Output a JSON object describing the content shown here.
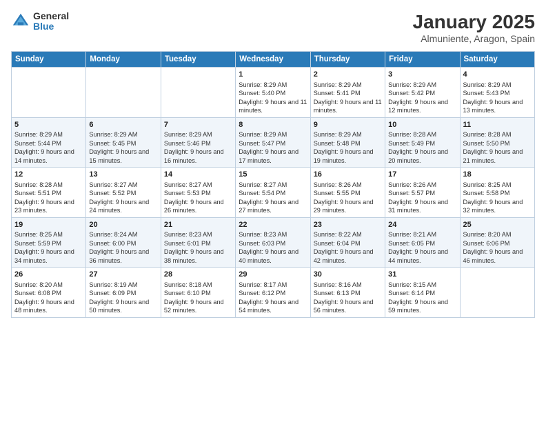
{
  "header": {
    "logo_general": "General",
    "logo_blue": "Blue",
    "title": "January 2025",
    "subtitle": "Almuniente, Aragon, Spain"
  },
  "weekdays": [
    "Sunday",
    "Monday",
    "Tuesday",
    "Wednesday",
    "Thursday",
    "Friday",
    "Saturday"
  ],
  "weeks": [
    [
      {
        "day": "",
        "sunrise": "",
        "sunset": "",
        "daylight": ""
      },
      {
        "day": "",
        "sunrise": "",
        "sunset": "",
        "daylight": ""
      },
      {
        "day": "",
        "sunrise": "",
        "sunset": "",
        "daylight": ""
      },
      {
        "day": "1",
        "sunrise": "Sunrise: 8:29 AM",
        "sunset": "Sunset: 5:40 PM",
        "daylight": "Daylight: 9 hours and 11 minutes."
      },
      {
        "day": "2",
        "sunrise": "Sunrise: 8:29 AM",
        "sunset": "Sunset: 5:41 PM",
        "daylight": "Daylight: 9 hours and 11 minutes."
      },
      {
        "day": "3",
        "sunrise": "Sunrise: 8:29 AM",
        "sunset": "Sunset: 5:42 PM",
        "daylight": "Daylight: 9 hours and 12 minutes."
      },
      {
        "day": "4",
        "sunrise": "Sunrise: 8:29 AM",
        "sunset": "Sunset: 5:43 PM",
        "daylight": "Daylight: 9 hours and 13 minutes."
      }
    ],
    [
      {
        "day": "5",
        "sunrise": "Sunrise: 8:29 AM",
        "sunset": "Sunset: 5:44 PM",
        "daylight": "Daylight: 9 hours and 14 minutes."
      },
      {
        "day": "6",
        "sunrise": "Sunrise: 8:29 AM",
        "sunset": "Sunset: 5:45 PM",
        "daylight": "Daylight: 9 hours and 15 minutes."
      },
      {
        "day": "7",
        "sunrise": "Sunrise: 8:29 AM",
        "sunset": "Sunset: 5:46 PM",
        "daylight": "Daylight: 9 hours and 16 minutes."
      },
      {
        "day": "8",
        "sunrise": "Sunrise: 8:29 AM",
        "sunset": "Sunset: 5:47 PM",
        "daylight": "Daylight: 9 hours and 17 minutes."
      },
      {
        "day": "9",
        "sunrise": "Sunrise: 8:29 AM",
        "sunset": "Sunset: 5:48 PM",
        "daylight": "Daylight: 9 hours and 19 minutes."
      },
      {
        "day": "10",
        "sunrise": "Sunrise: 8:28 AM",
        "sunset": "Sunset: 5:49 PM",
        "daylight": "Daylight: 9 hours and 20 minutes."
      },
      {
        "day": "11",
        "sunrise": "Sunrise: 8:28 AM",
        "sunset": "Sunset: 5:50 PM",
        "daylight": "Daylight: 9 hours and 21 minutes."
      }
    ],
    [
      {
        "day": "12",
        "sunrise": "Sunrise: 8:28 AM",
        "sunset": "Sunset: 5:51 PM",
        "daylight": "Daylight: 9 hours and 23 minutes."
      },
      {
        "day": "13",
        "sunrise": "Sunrise: 8:27 AM",
        "sunset": "Sunset: 5:52 PM",
        "daylight": "Daylight: 9 hours and 24 minutes."
      },
      {
        "day": "14",
        "sunrise": "Sunrise: 8:27 AM",
        "sunset": "Sunset: 5:53 PM",
        "daylight": "Daylight: 9 hours and 26 minutes."
      },
      {
        "day": "15",
        "sunrise": "Sunrise: 8:27 AM",
        "sunset": "Sunset: 5:54 PM",
        "daylight": "Daylight: 9 hours and 27 minutes."
      },
      {
        "day": "16",
        "sunrise": "Sunrise: 8:26 AM",
        "sunset": "Sunset: 5:55 PM",
        "daylight": "Daylight: 9 hours and 29 minutes."
      },
      {
        "day": "17",
        "sunrise": "Sunrise: 8:26 AM",
        "sunset": "Sunset: 5:57 PM",
        "daylight": "Daylight: 9 hours and 31 minutes."
      },
      {
        "day": "18",
        "sunrise": "Sunrise: 8:25 AM",
        "sunset": "Sunset: 5:58 PM",
        "daylight": "Daylight: 9 hours and 32 minutes."
      }
    ],
    [
      {
        "day": "19",
        "sunrise": "Sunrise: 8:25 AM",
        "sunset": "Sunset: 5:59 PM",
        "daylight": "Daylight: 9 hours and 34 minutes."
      },
      {
        "day": "20",
        "sunrise": "Sunrise: 8:24 AM",
        "sunset": "Sunset: 6:00 PM",
        "daylight": "Daylight: 9 hours and 36 minutes."
      },
      {
        "day": "21",
        "sunrise": "Sunrise: 8:23 AM",
        "sunset": "Sunset: 6:01 PM",
        "daylight": "Daylight: 9 hours and 38 minutes."
      },
      {
        "day": "22",
        "sunrise": "Sunrise: 8:23 AM",
        "sunset": "Sunset: 6:03 PM",
        "daylight": "Daylight: 9 hours and 40 minutes."
      },
      {
        "day": "23",
        "sunrise": "Sunrise: 8:22 AM",
        "sunset": "Sunset: 6:04 PM",
        "daylight": "Daylight: 9 hours and 42 minutes."
      },
      {
        "day": "24",
        "sunrise": "Sunrise: 8:21 AM",
        "sunset": "Sunset: 6:05 PM",
        "daylight": "Daylight: 9 hours and 44 minutes."
      },
      {
        "day": "25",
        "sunrise": "Sunrise: 8:20 AM",
        "sunset": "Sunset: 6:06 PM",
        "daylight": "Daylight: 9 hours and 46 minutes."
      }
    ],
    [
      {
        "day": "26",
        "sunrise": "Sunrise: 8:20 AM",
        "sunset": "Sunset: 6:08 PM",
        "daylight": "Daylight: 9 hours and 48 minutes."
      },
      {
        "day": "27",
        "sunrise": "Sunrise: 8:19 AM",
        "sunset": "Sunset: 6:09 PM",
        "daylight": "Daylight: 9 hours and 50 minutes."
      },
      {
        "day": "28",
        "sunrise": "Sunrise: 8:18 AM",
        "sunset": "Sunset: 6:10 PM",
        "daylight": "Daylight: 9 hours and 52 minutes."
      },
      {
        "day": "29",
        "sunrise": "Sunrise: 8:17 AM",
        "sunset": "Sunset: 6:12 PM",
        "daylight": "Daylight: 9 hours and 54 minutes."
      },
      {
        "day": "30",
        "sunrise": "Sunrise: 8:16 AM",
        "sunset": "Sunset: 6:13 PM",
        "daylight": "Daylight: 9 hours and 56 minutes."
      },
      {
        "day": "31",
        "sunrise": "Sunrise: 8:15 AM",
        "sunset": "Sunset: 6:14 PM",
        "daylight": "Daylight: 9 hours and 59 minutes."
      },
      {
        "day": "",
        "sunrise": "",
        "sunset": "",
        "daylight": ""
      }
    ]
  ]
}
